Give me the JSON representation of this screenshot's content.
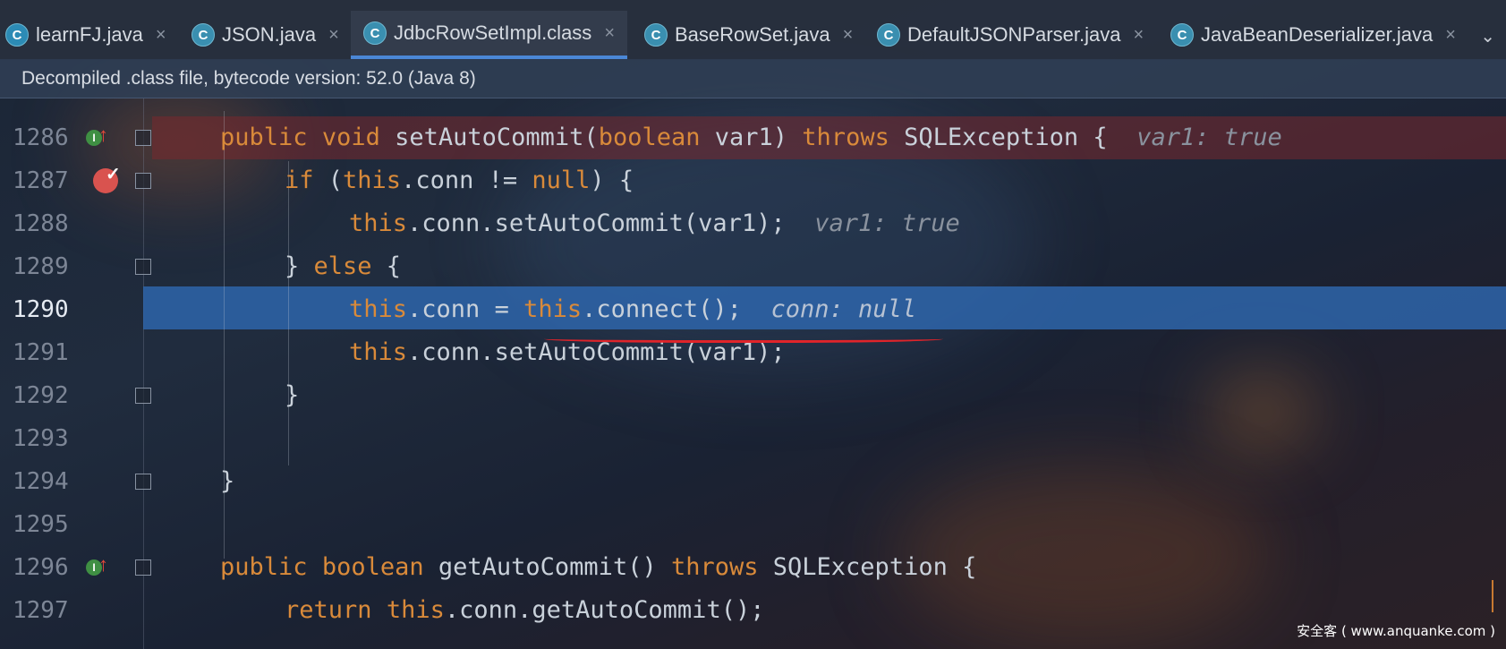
{
  "tabs": [
    {
      "label": "learnFJ.java",
      "icon": "run-class-icon"
    },
    {
      "label": "JSON.java",
      "icon": "class-icon"
    },
    {
      "label": "JdbcRowSetImpl.class",
      "icon": "class-icon",
      "active": true
    },
    {
      "label": "BaseRowSet.java",
      "icon": "class-icon"
    },
    {
      "label": "DefaultJSONParser.java",
      "icon": "class-icon"
    },
    {
      "label": "JavaBeanDeserializer.java",
      "icon": "class-icon"
    }
  ],
  "tab_close_glyph": "×",
  "tab_icon_letter": "C",
  "banner": "Decompiled .class file, bytecode version: 52.0 (Java 8)",
  "code": {
    "lines": [
      {
        "num": "1286",
        "parts": [
          "public",
          "void",
          "setAutoCommit(",
          "boolean",
          "var1) ",
          "throws",
          " SQLException {",
          "var1: true"
        ]
      },
      {
        "num": "1287",
        "parts": [
          "if",
          " (",
          "this",
          ".conn != ",
          "null",
          ") {"
        ]
      },
      {
        "num": "1288",
        "parts": [
          "this",
          ".conn.setAutoCommit(var1);",
          "var1: true"
        ]
      },
      {
        "num": "1289",
        "parts": [
          "} ",
          "else",
          " {"
        ]
      },
      {
        "num": "1290",
        "parts": [
          "this",
          ".conn = ",
          "this",
          ".connect();",
          "conn: null"
        ]
      },
      {
        "num": "1291",
        "parts": [
          "this",
          ".conn.setAutoCommit(var1);"
        ]
      },
      {
        "num": "1292",
        "parts": [
          "}"
        ]
      },
      {
        "num": "1293",
        "parts": []
      },
      {
        "num": "1294",
        "parts": [
          "}"
        ]
      },
      {
        "num": "1295",
        "parts": []
      },
      {
        "num": "1296",
        "parts": [
          "public",
          "boolean",
          "getAutoCommit() ",
          "throws",
          " SQLException {"
        ]
      },
      {
        "num": "1297",
        "parts": [
          "return",
          "this",
          ".conn.getAutoCommit();"
        ]
      }
    ]
  },
  "gutter": {
    "implements_letter": "I",
    "up_arrow": "↑",
    "breakpoint_check": "✓"
  },
  "colors": {
    "keyword": "#d98a3a",
    "breakpoint_line": "#782d2d",
    "current_line": "#2e65aa",
    "underline": "#e0242a"
  },
  "watermark": "安全客 ( www.anquanke.com )"
}
